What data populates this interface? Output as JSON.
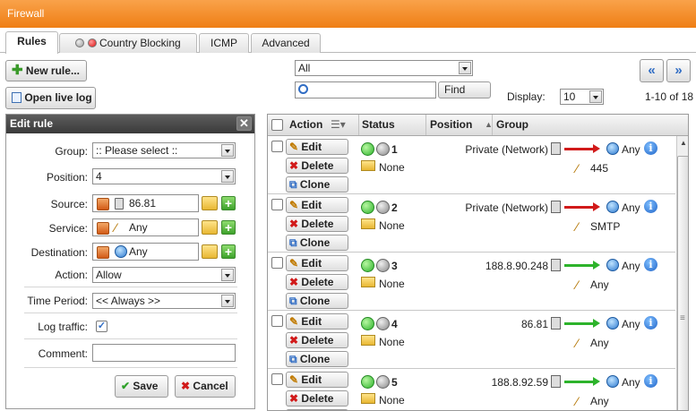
{
  "window": {
    "title": "Firewall"
  },
  "tabs": [
    {
      "label": "Rules",
      "active": true
    },
    {
      "label": "Country Blocking",
      "active": false
    },
    {
      "label": "ICMP",
      "active": false
    },
    {
      "label": "Advanced",
      "active": false
    }
  ],
  "toolbar": {
    "new_rule": "New rule...",
    "open_live_log": "Open live log",
    "filter_value": "All",
    "find_label": "Find",
    "display_label": "Display:",
    "display_value": "10",
    "range_label": "1-10 of 18"
  },
  "edit_rule": {
    "title": "Edit rule",
    "group_label": "Group:",
    "group_value": ":: Please select ::",
    "position_label": "Position:",
    "position_value": "4",
    "source_label": "Source:",
    "source_value": "86.81",
    "service_label": "Service:",
    "service_value": "Any",
    "destination_label": "Destination:",
    "destination_value": "Any",
    "action_label": "Action:",
    "action_value": "Allow",
    "time_label": "Time Period:",
    "time_value": "<< Always >>",
    "log_label": "Log traffic:",
    "log_checked": true,
    "comment_label": "Comment:",
    "comment_value": "",
    "save_label": "Save",
    "cancel_label": "Cancel"
  },
  "table": {
    "headers": {
      "action": "Action",
      "status": "Status",
      "position": "Position",
      "group": "Group"
    },
    "buttons": {
      "edit": "Edit",
      "delete": "Delete",
      "clone": "Clone"
    },
    "rows": [
      {
        "num": "1",
        "group": "None",
        "source": "Private (Network)",
        "arrow": "red",
        "dest": "Any",
        "service": "445"
      },
      {
        "num": "2",
        "group": "None",
        "source": "Private (Network)",
        "arrow": "red",
        "dest": "Any",
        "service": "SMTP"
      },
      {
        "num": "3",
        "group": "None",
        "source": "188.8.90.248",
        "arrow": "green",
        "dest": "Any",
        "service": "Any"
      },
      {
        "num": "4",
        "group": "None",
        "source": "86.81",
        "arrow": "green",
        "dest": "Any",
        "service": "Any"
      },
      {
        "num": "5",
        "group": "None",
        "source": "188.8.92.59",
        "arrow": "green",
        "dest": "Any",
        "service": "Any"
      }
    ]
  },
  "colors": {
    "accent": "#ef7e14",
    "allow": "#2db32b",
    "deny": "#d11a1a",
    "link": "#2f6cc4"
  }
}
